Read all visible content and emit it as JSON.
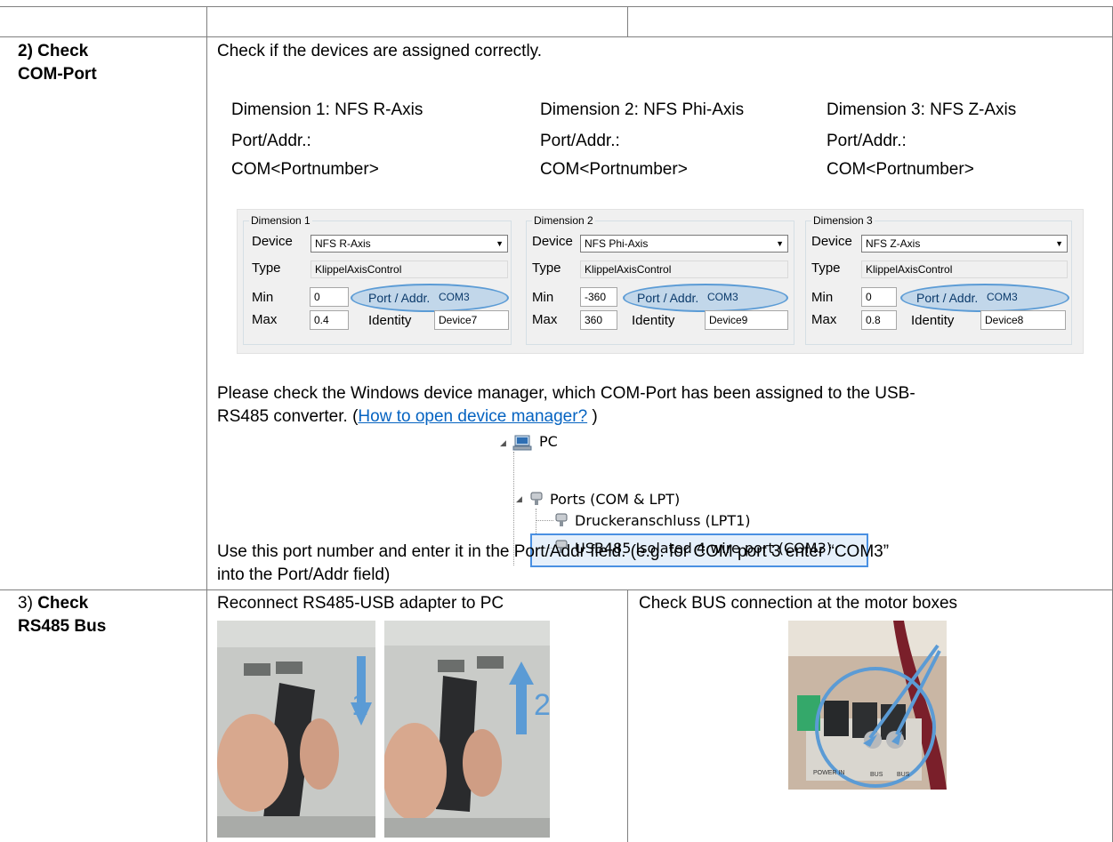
{
  "step2": {
    "heading_line1": "2) Check",
    "heading_line2": "COM-Port",
    "intro": "Check if the devices are assigned correctly.",
    "dimensions": [
      {
        "line1": "Dimension 1: NFS R-Axis",
        "line2": "Port/Addr.:",
        "line3": "COM<Portnumber>"
      },
      {
        "line1": "Dimension 2: NFS Phi-Axis",
        "line2": "Port/Addr.:",
        "line3": "COM<Portnumber>"
      },
      {
        "line1": "Dimension 3: NFS Z-Axis",
        "line2": "Port/Addr.:",
        "line3": "COM<Portnumber>"
      }
    ],
    "panel": {
      "groups": [
        {
          "title": "Dimension 1",
          "device_label": "Device",
          "device": "NFS R-Axis",
          "type_label": "Type",
          "type": "KlippelAxisControl",
          "min_label": "Min",
          "min": "0",
          "max_label": "Max",
          "max": "0.4",
          "port_label": "Port / Addr.",
          "port": "COM3",
          "identity_label": "Identity",
          "identity": "Device7"
        },
        {
          "title": "Dimension 2",
          "device_label": "Device",
          "device": "NFS Phi-Axis",
          "type_label": "Type",
          "type": "KlippelAxisControl",
          "min_label": "Min",
          "min": "-360",
          "max_label": "Max",
          "max": "360",
          "port_label": "Port / Addr.",
          "port": "COM3",
          "identity_label": "Identity",
          "identity": "Device9"
        },
        {
          "title": "Dimension 3",
          "device_label": "Device",
          "device": "NFS Z-Axis",
          "type_label": "Type",
          "type": "KlippelAxisControl",
          "min_label": "Min",
          "min": "0",
          "max_label": "Max",
          "max": "0.8",
          "port_label": "Port / Addr.",
          "port": "COM3",
          "identity_label": "Identity",
          "identity": "Device8"
        }
      ]
    },
    "devmgr_line1": "Please check the Windows device manager, which COM-Port has been assigned to the USB-",
    "devmgr_line2_pre": "RS485 converter. (",
    "devmgr_link": "How to open device manager?",
    "devmgr_line2_post": " )",
    "tree": {
      "root": "PC",
      "ports": "Ports (COM & LPT)",
      "lpt": "Druckeranschluss (LPT1)",
      "usb": "USB485 Isolated 4 wire port (COM3)"
    },
    "outro_line1": "Use this port number and enter it in the Port/Addr field. (e.g. for COM port 3 enter “COM3”",
    "outro_line2": "into the Port/Addr field)"
  },
  "step3": {
    "heading_prefix": "3) ",
    "heading_bold1": "Check",
    "heading_line2": "RS485 Bus",
    "left_caption": "Reconnect RS485-USB adapter to PC",
    "right_caption": "Check BUS connection at the motor boxes",
    "photo1_number": "1",
    "photo2_number": "2",
    "motor_labels": [
      "POWER IN",
      "BUS",
      "BUS"
    ]
  },
  "colors": {
    "accent": "#5b9bd5",
    "link": "#0563c1",
    "border": "#7f7f7f"
  }
}
